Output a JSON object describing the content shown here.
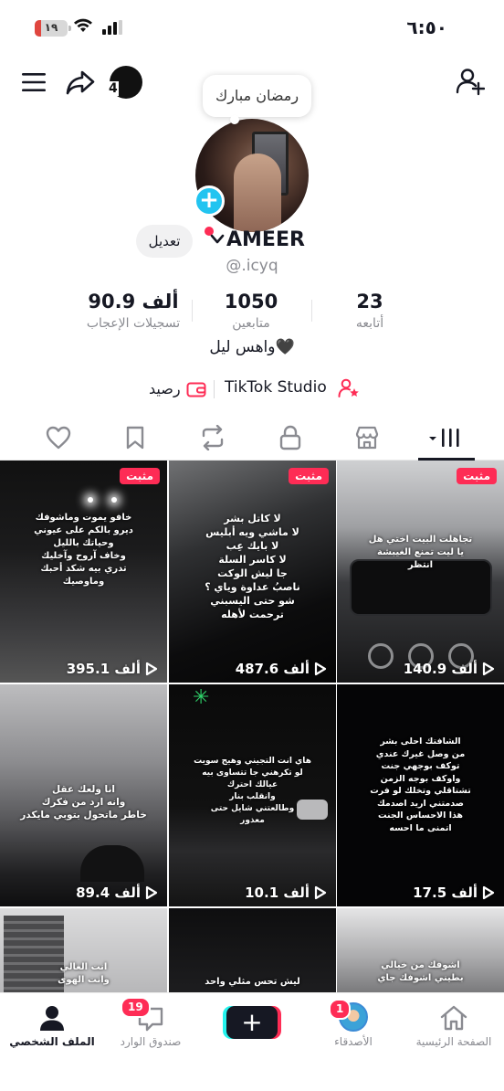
{
  "status_bar": {
    "time": "٦:٥٠",
    "battery": "١٩",
    "battery_level": 0.19
  },
  "header": {
    "story_count": "4",
    "note": "رمضان مبارك"
  },
  "profile": {
    "username": "AMEER",
    "handle": "@.icyq",
    "edit_label": "تعديل",
    "bio": "واهس ليل🖤",
    "studio_label": "TikTok Studio",
    "balance_label": "رصيد"
  },
  "stats": {
    "likes": {
      "value": "90.9 ألف",
      "label": "تسجيلات الإعجاب"
    },
    "followers": {
      "value": "1050",
      "label": "متابعين"
    },
    "following": {
      "value": "23",
      "label": "أتابعه"
    }
  },
  "tabs": [
    {
      "name": "videos",
      "icon": "grid-icon"
    },
    {
      "name": "shop",
      "icon": "shop-icon"
    },
    {
      "name": "private",
      "icon": "lock-icon"
    },
    {
      "name": "reposts",
      "icon": "repost-icon"
    },
    {
      "name": "favorites",
      "icon": "bookmark-icon"
    },
    {
      "name": "liked",
      "icon": "heart-icon"
    }
  ],
  "videos": [
    {
      "views": "140.9 ألف",
      "pinned": "مثبت",
      "lines": [
        "تجاهلت البيت اختي هل",
        "يا ليت تمنع الغيبشة",
        "انتظر"
      ],
      "bg": "car"
    },
    {
      "views": "487.6 ألف",
      "pinned": "مثبت",
      "lines": [
        "لا كاتل بشر",
        "لا ماشي ويه أبليس",
        "لا بايك عِب",
        "لا كاسر السلة",
        "جا ليش الوكت",
        "ناصبُ عداوة وياي ؟",
        "شو حتى اليسبني",
        "ترحمت لأهله"
      ],
      "bg": "dark"
    },
    {
      "views": "395.1 ألف",
      "pinned": "مثبت",
      "lines": [
        "خافو يموت وماشوفك",
        "ديرو بالكم على عيوني",
        "وحياتك بالليل",
        "وخاف آروح وآخليك",
        "تدري بيه شكد أحبك",
        "وماوصيك"
      ],
      "bg": "street"
    },
    {
      "views": "17.5 ألف",
      "pinned": "",
      "lines": [
        "الشافتك احلى بشر",
        "من وصل غيرك عندي",
        "توكف بوجهي جنت",
        "واوكف بوجه الزمن",
        "تشتاقلي وتخلك لو فرت",
        "صدمتني اريد اصدمك",
        "هذا الاحساس الجنت",
        "اتمنى ما احسه"
      ],
      "bg": "night"
    },
    {
      "views": "10.1 ألف",
      "pinned": "",
      "lines": [
        "هاي انت التجيني وهيج سويت",
        "لو تكرهني جا تتساوى بيه",
        "عيالك احترك",
        "وانقلب بنار",
        "وطالعتني شايل حتى",
        "معذور"
      ],
      "bg": "palm"
    },
    {
      "views": "89.4 ألف",
      "pinned": "",
      "lines": [
        "انا ولعك عقل",
        "وانه ارد من فكرك",
        "خاطر ماتحول بتوبي مايكدر"
      ],
      "bg": "cloud"
    },
    {
      "views": "",
      "pinned": "",
      "lines": [
        "اشوفك من خيالي",
        "بطيني اشوفك جاي"
      ],
      "bg": "grey"
    },
    {
      "views": "",
      "pinned": "",
      "lines": [
        "ليش تحس مثلي واحد"
      ],
      "bg": "dark2"
    },
    {
      "views": "",
      "pinned": "",
      "lines": [
        "انت الغالي",
        "وانت الهوى"
      ],
      "bg": "building"
    }
  ],
  "bottom_nav": {
    "home": "الصفحة الرئيسية",
    "friends": "الأصدقاء",
    "friends_badge": "1",
    "inbox": "صندوق الوارد",
    "inbox_badge": "19",
    "profile": "الملف الشخصي"
  }
}
